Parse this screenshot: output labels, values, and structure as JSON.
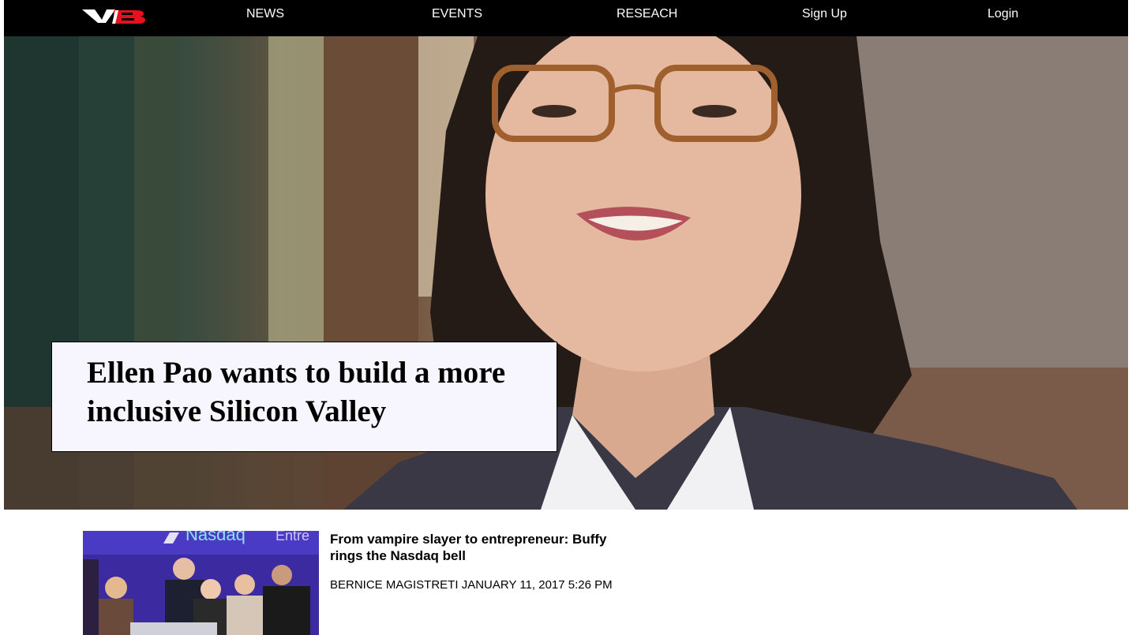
{
  "header": {
    "logo_icon": "vb-logo-icon",
    "logo_colors": {
      "letters": "#ffffff",
      "accent": "#e8101c"
    },
    "nav": [
      {
        "key": "news",
        "label": "NEWS"
      },
      {
        "key": "events",
        "label": "EVENTS"
      },
      {
        "key": "research",
        "label": "RESEACH"
      },
      {
        "key": "signup",
        "label": "Sign Up"
      },
      {
        "key": "login",
        "label": "Login"
      }
    ]
  },
  "hero": {
    "headline": "Ellen Pao wants to build a more inclusive Silicon Valley",
    "image_icon": "hero-portrait-photo"
  },
  "articles": [
    {
      "title": "From vampire slayer to entrepreneur: Buffy rings the Nasdaq bell",
      "author": "BERNICE MAGISTRETI",
      "date": "JANUARY 11, 2017 5:26 PM",
      "thumbnail_icon": "nasdaq-bell-photo",
      "thumbnail_text": "Nasdaq",
      "thumbnail_partial_text": "Entre"
    }
  ],
  "colors": {
    "nav_background": "#000000",
    "nav_text": "#ffffff",
    "headline_box_background": "#f7f6ff",
    "page_background": "#ffffff"
  }
}
